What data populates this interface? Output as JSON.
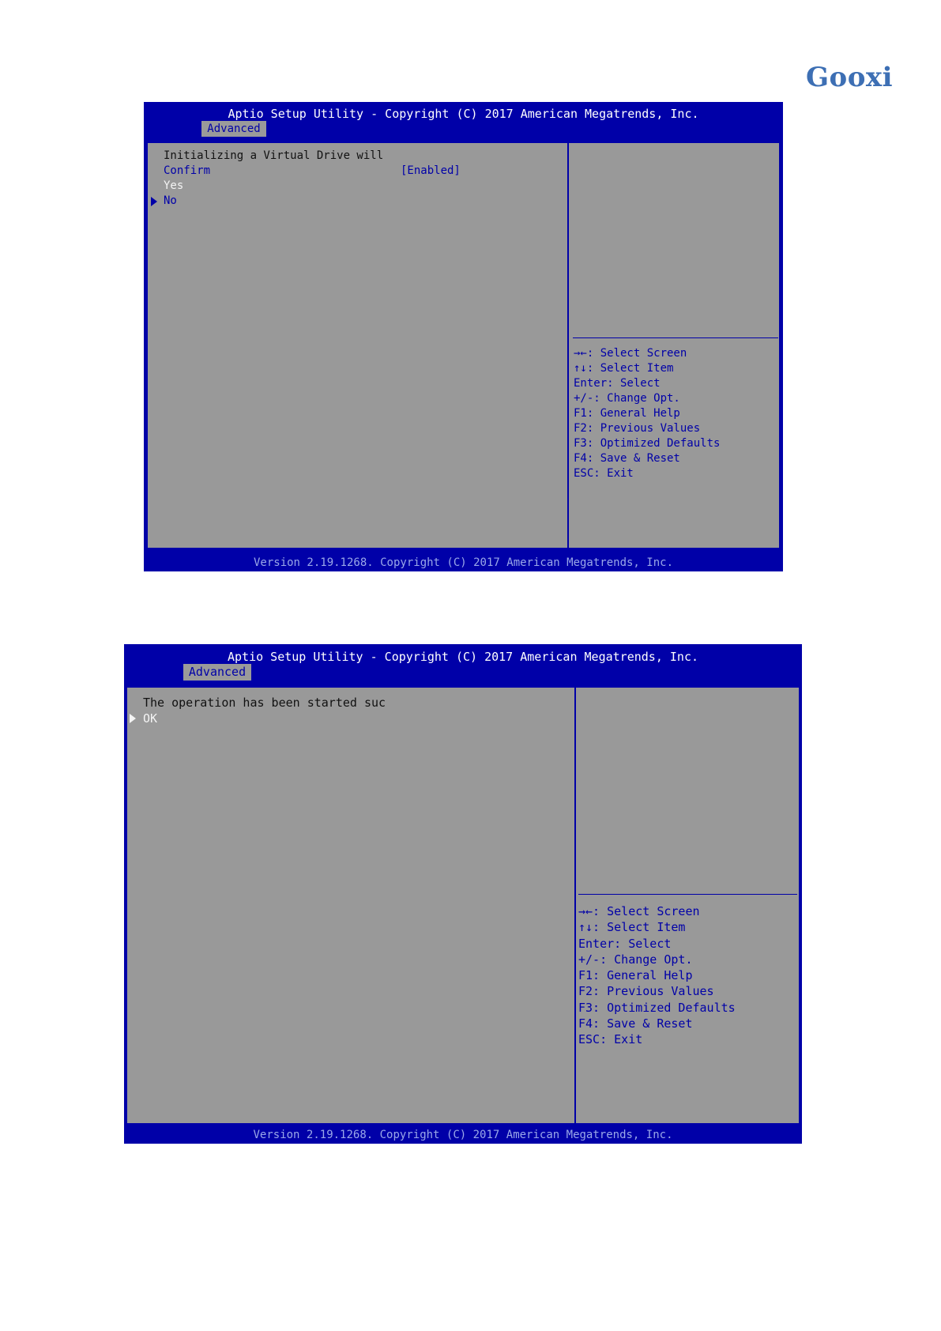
{
  "logo": {
    "text": "Gooxi"
  },
  "screen1": {
    "header_title": "Aptio Setup Utility - Copyright (C) 2017 American Megatrends, Inc.",
    "active_tab": "Advanced",
    "message": "Initializing a Virtual Drive will",
    "option_label": "Confirm",
    "option_value": "[Enabled]",
    "choices": [
      "Yes",
      "No"
    ],
    "selected_choice": "No",
    "help": [
      "→←: Select Screen",
      "↑↓: Select Item",
      "Enter: Select",
      "+/-: Change Opt.",
      "F1: General Help",
      "F2: Previous Values",
      "F3: Optimized Defaults",
      "F4: Save & Reset",
      "ESC: Exit"
    ],
    "footer": "Version 2.19.1268. Copyright (C) 2017 American Megatrends, Inc."
  },
  "screen2": {
    "header_title": "Aptio Setup Utility - Copyright (C) 2017 American Megatrends, Inc.",
    "active_tab": "Advanced",
    "message": "The operation has been started suc",
    "choices": [
      "OK"
    ],
    "selected_choice": "OK",
    "help": [
      "→←: Select Screen",
      "↑↓: Select Item",
      "Enter: Select",
      "+/-: Change Opt.",
      "F1: General Help",
      "F2: Previous Values",
      "F3: Optimized Defaults",
      "F4: Save & Reset",
      "ESC: Exit"
    ],
    "footer": "Version 2.19.1268. Copyright (C) 2017 American Megatrends, Inc."
  }
}
